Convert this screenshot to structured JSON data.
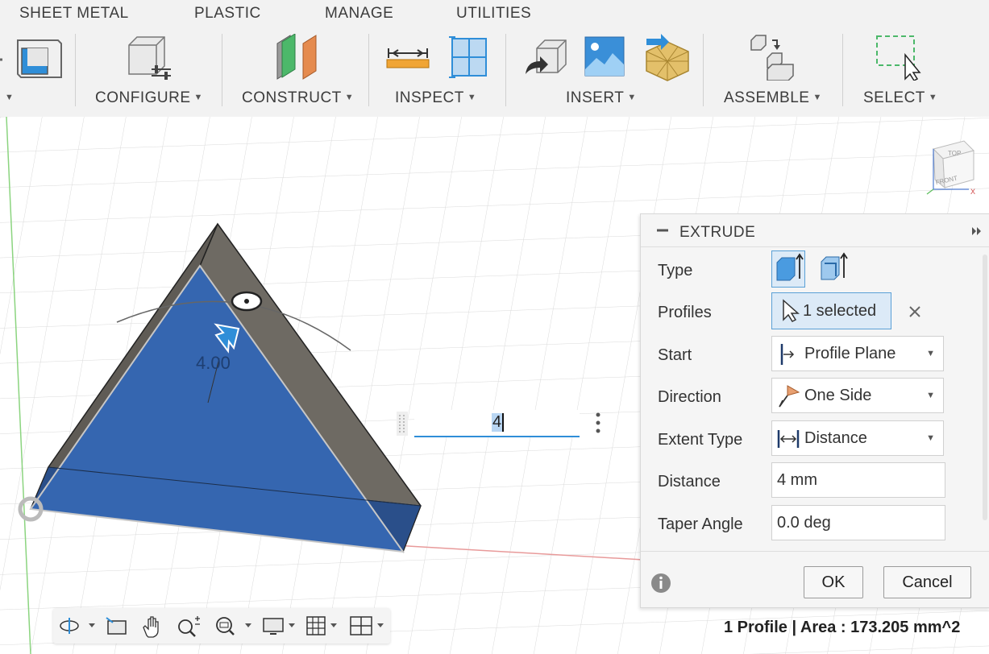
{
  "tabs": [
    "SHEET METAL",
    "PLASTIC",
    "MANAGE",
    "UTILITIES"
  ],
  "toolbar_groups": {
    "configure": "CONFIGURE",
    "construct": "CONSTRUCT",
    "inspect": "INSPECT",
    "insert": "INSERT",
    "assemble": "ASSEMBLE",
    "select": "SELECT"
  },
  "canvas": {
    "dimension_label": "4.00",
    "distance_input_value": "4"
  },
  "view_cube": {
    "top": "TOP",
    "front": "FRONT",
    "axis_x": "X"
  },
  "extrude_panel": {
    "title": "EXTRUDE",
    "type_label": "Type",
    "profiles_label": "Profiles",
    "profiles_value": "1 selected",
    "start_label": "Start",
    "start_value": "Profile Plane",
    "direction_label": "Direction",
    "direction_value": "One Side",
    "extent_type_label": "Extent Type",
    "extent_type_value": "Distance",
    "distance_label": "Distance",
    "distance_value": "4 mm",
    "taper_label": "Taper Angle",
    "taper_value": "0.0 deg",
    "ok_label": "OK",
    "cancel_label": "Cancel"
  },
  "status_bar": {
    "text": "1 Profile | Area : 173.205 mm^2"
  },
  "colors": {
    "profile_blue": "#3566b0",
    "body_gray": "#6e6a63",
    "accent": "#1f88d6",
    "selection_bg": "#dceaf7"
  }
}
